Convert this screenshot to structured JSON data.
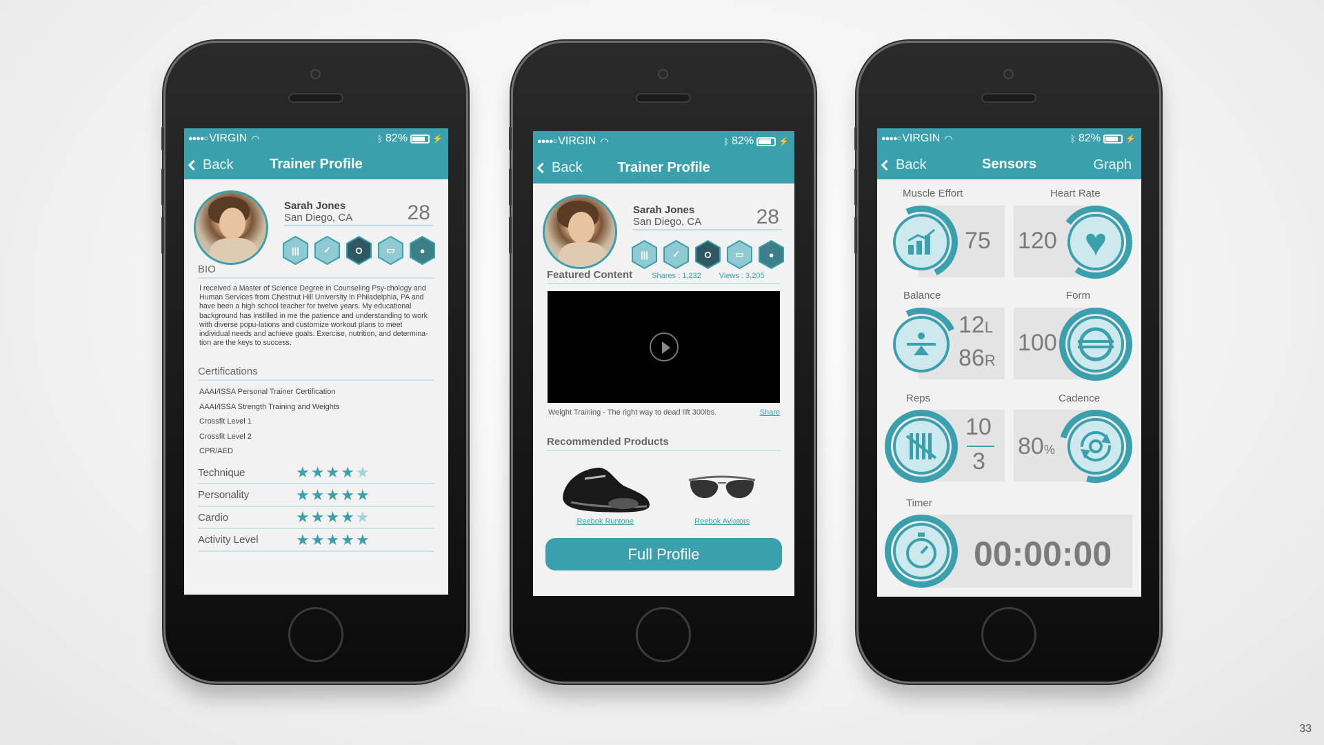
{
  "status": {
    "carrier": "VIRGIN",
    "battery": "82%",
    "signal_dots": "●●●●○"
  },
  "screen1": {
    "back_label": "Back",
    "title": "Trainer Profile",
    "name": "Sarah Jones",
    "city": "San Diego, CA",
    "age": "28",
    "badges": [
      "badge-bars-icon",
      "badge-shield-icon",
      "badge-o-icon",
      "badge-screen-icon",
      "badge-person-icon"
    ],
    "bio_title": "BIO",
    "bio_text": "I received a Master of Science Degree in Counseling Psy-chology and Human Services from Chestnut Hill University in Philadelphia, PA and have been a high school teacher for twelve years. My educational background has instilled in me the patience and understanding to work with diverse popu-lations and customize workout plans to meet individual needs and achieve goals. Exercise, nutrition, and determina-tion are the keys to success.",
    "cert_title": "Certifications",
    "certs": [
      "AAAI/ISSA Personal Trainer Certification",
      "AAAI/ISSA Strength Training and Weights",
      "Crossfit Level 1",
      "Crossfit Level 2",
      "CPR/AED"
    ],
    "ratings": [
      {
        "label": "Technique",
        "stars": 4.5
      },
      {
        "label": "Personality",
        "stars": 5
      },
      {
        "label": "Cardio",
        "stars": 4.5
      },
      {
        "label": "Activity Level",
        "stars": 5
      }
    ]
  },
  "screen2": {
    "back_label": "Back",
    "title": "Trainer Profile",
    "name": "Sarah Jones",
    "city": "San Diego, CA",
    "age": "28",
    "featured_title": "Featured Content",
    "shares": "Shares : 1,232",
    "views": "Views : 3,205",
    "video_caption": "Weight Training - The right way to dead lift 300lbs.",
    "share_link": "Share",
    "recommended_title": "Recommended Products",
    "products": [
      "Reebok Runtone",
      "Reebok Aviators"
    ],
    "full_profile": "Full Profile"
  },
  "screen3": {
    "back_label": "Back",
    "title": "Sensors",
    "graph_label": "Graph",
    "muscle_effort": {
      "label": "Muscle Effort",
      "value": "75"
    },
    "heart_rate": {
      "label": "Heart Rate",
      "value": "120"
    },
    "balance": {
      "label": "Balance",
      "left": "12",
      "left_unit": "L",
      "right": "86",
      "right_unit": "R"
    },
    "form": {
      "label": "Form",
      "value": "100"
    },
    "reps": {
      "label": "Reps",
      "top": "10",
      "bottom": "3"
    },
    "cadence": {
      "label": "Cadence",
      "value": "80",
      "unit": "%"
    },
    "timer": {
      "label": "Timer",
      "value": "00:00:00"
    }
  },
  "slide_number": "33",
  "colors": {
    "accent": "#3aa0ad",
    "accent_light": "#cde9ed",
    "screen_bg": "#f2f2f2"
  }
}
